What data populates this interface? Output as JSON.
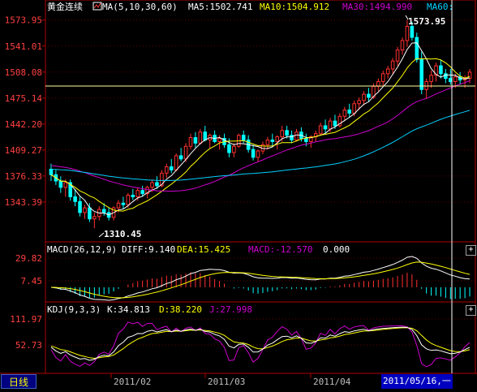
{
  "colors": {
    "background": "#000000",
    "frame": "#b00000",
    "up_candle": "#ff3030",
    "down_candle": "#00ffff",
    "ma5": "#ffffff",
    "ma10": "#ffff00",
    "ma30": "#d000d0",
    "ma60": "#00d0ff",
    "axis_text": "#ff4040",
    "crosshair": "#ffffff",
    "hline": "#ffffa0"
  },
  "main_panel": {
    "instrument": "黄金连续",
    "ma_prefix": "MA(5,10,30,60)",
    "ma5_label": "MA5:1502.741",
    "ma10_label": "MA10:1504.912",
    "ma30_label": "MA30:1494.990",
    "ma60_label": "MA60:",
    "high_marker": "1573.95",
    "low_marker": "1310.45",
    "y_ticks": [
      "1573.95",
      "1541.01",
      "1508.08",
      "1475.14",
      "1442.20",
      "1409.27",
      "1376.33",
      "1343.39"
    ]
  },
  "macd_panel": {
    "label": "MACD(26,12,9)",
    "diff_label": "DIFF:9.140",
    "dea_label": "DEA:15.425",
    "macd_label": "MACD:-12.570",
    "zero_label": "0.000",
    "y_ticks": [
      "29.82",
      "7.45"
    ]
  },
  "kdj_panel": {
    "label": "KDJ(9,3,3)",
    "k_label": "K:34.813",
    "d_label": "D:38.220",
    "j_label": "J:27.998",
    "y_ticks": [
      "111.97",
      "52.73"
    ]
  },
  "footer": {
    "period_button": "日线",
    "dates": [
      "2011/02",
      "2011/03",
      "2011/04"
    ],
    "cursor_date": "2011/05/16,一"
  },
  "chart_data": [
    {
      "type": "candlestick",
      "title": "黄金连续",
      "ylim": [
        1297,
        1585
      ],
      "ohlc": [
        [
          1385,
          1392,
          1370,
          1378
        ],
        [
          1378,
          1384,
          1365,
          1370
        ],
        [
          1370,
          1376,
          1355,
          1362
        ],
        [
          1362,
          1372,
          1350,
          1368
        ],
        [
          1368,
          1372,
          1345,
          1350
        ],
        [
          1350,
          1360,
          1338,
          1344
        ],
        [
          1344,
          1350,
          1325,
          1330
        ],
        [
          1330,
          1340,
          1322,
          1336
        ],
        [
          1336,
          1342,
          1318,
          1322
        ],
        [
          1322,
          1330,
          1310,
          1325
        ],
        [
          1325,
          1338,
          1320,
          1334
        ],
        [
          1334,
          1342,
          1326,
          1330
        ],
        [
          1330,
          1336,
          1320,
          1324
        ],
        [
          1324,
          1338,
          1320,
          1336
        ],
        [
          1336,
          1346,
          1330,
          1342
        ],
        [
          1342,
          1350,
          1335,
          1340
        ],
        [
          1340,
          1355,
          1336,
          1352
        ],
        [
          1352,
          1360,
          1346,
          1350
        ],
        [
          1350,
          1362,
          1345,
          1358
        ],
        [
          1358,
          1364,
          1350,
          1354
        ],
        [
          1354,
          1364,
          1348,
          1362
        ],
        [
          1362,
          1372,
          1356,
          1368
        ],
        [
          1368,
          1376,
          1360,
          1364
        ],
        [
          1364,
          1384,
          1362,
          1380
        ],
        [
          1380,
          1392,
          1374,
          1388
        ],
        [
          1388,
          1398,
          1380,
          1384
        ],
        [
          1384,
          1405,
          1382,
          1402
        ],
        [
          1402,
          1412,
          1395,
          1398
        ],
        [
          1398,
          1418,
          1394,
          1414
        ],
        [
          1414,
          1430,
          1410,
          1425
        ],
        [
          1425,
          1432,
          1412,
          1418
        ],
        [
          1418,
          1436,
          1416,
          1432
        ],
        [
          1432,
          1440,
          1420,
          1422
        ],
        [
          1422,
          1430,
          1412,
          1428
        ],
        [
          1428,
          1434,
          1418,
          1420
        ],
        [
          1420,
          1428,
          1410,
          1424
        ],
        [
          1424,
          1430,
          1412,
          1416
        ],
        [
          1416,
          1424,
          1400,
          1406
        ],
        [
          1406,
          1418,
          1400,
          1414
        ],
        [
          1414,
          1430,
          1412,
          1428
        ],
        [
          1428,
          1434,
          1418,
          1422
        ],
        [
          1422,
          1428,
          1406,
          1410
        ],
        [
          1410,
          1416,
          1396,
          1400
        ],
        [
          1400,
          1410,
          1394,
          1408
        ],
        [
          1408,
          1420,
          1404,
          1416
        ],
        [
          1416,
          1426,
          1410,
          1422
        ],
        [
          1422,
          1430,
          1414,
          1420
        ],
        [
          1420,
          1428,
          1410,
          1426
        ],
        [
          1426,
          1440,
          1420,
          1434
        ],
        [
          1434,
          1440,
          1424,
          1428
        ],
        [
          1428,
          1434,
          1418,
          1422
        ],
        [
          1422,
          1436,
          1420,
          1432
        ],
        [
          1432,
          1438,
          1420,
          1424
        ],
        [
          1424,
          1430,
          1414,
          1420
        ],
        [
          1420,
          1428,
          1412,
          1426
        ],
        [
          1426,
          1434,
          1420,
          1430
        ],
        [
          1430,
          1444,
          1428,
          1440
        ],
        [
          1440,
          1448,
          1430,
          1436
        ],
        [
          1436,
          1450,
          1432,
          1446
        ],
        [
          1446,
          1454,
          1436,
          1440
        ],
        [
          1440,
          1456,
          1438,
          1452
        ],
        [
          1452,
          1464,
          1446,
          1460
        ],
        [
          1460,
          1468,
          1450,
          1456
        ],
        [
          1456,
          1472,
          1452,
          1468
        ],
        [
          1468,
          1476,
          1460,
          1472
        ],
        [
          1472,
          1484,
          1466,
          1480
        ],
        [
          1480,
          1488,
          1470,
          1476
        ],
        [
          1476,
          1494,
          1474,
          1490
        ],
        [
          1490,
          1500,
          1484,
          1496
        ],
        [
          1496,
          1510,
          1490,
          1506
        ],
        [
          1506,
          1516,
          1500,
          1512
        ],
        [
          1512,
          1526,
          1506,
          1522
        ],
        [
          1522,
          1540,
          1516,
          1536
        ],
        [
          1536,
          1552,
          1530,
          1548
        ],
        [
          1548,
          1574,
          1540,
          1566
        ],
        [
          1566,
          1572,
          1548,
          1552
        ],
        [
          1552,
          1558,
          1520,
          1524
        ],
        [
          1524,
          1534,
          1480,
          1486
        ],
        [
          1486,
          1500,
          1474,
          1496
        ],
        [
          1496,
          1510,
          1488,
          1504
        ],
        [
          1504,
          1520,
          1496,
          1516
        ],
        [
          1516,
          1524,
          1500,
          1506
        ],
        [
          1506,
          1512,
          1494,
          1500
        ],
        [
          1500,
          1512,
          1492,
          1496
        ],
        [
          1496,
          1506,
          1488,
          1502
        ],
        [
          1502,
          1508,
          1492,
          1498
        ],
        [
          1498,
          1504,
          1488,
          1500
        ],
        [
          1500,
          1512,
          1494,
          1508
        ]
      ]
    },
    {
      "type": "bar",
      "title": "MACD(26,12,9)",
      "series_names": [
        "DIFF",
        "DEA",
        "MACD"
      ]
    },
    {
      "type": "line",
      "title": "KDJ(9,3,3)",
      "series_names": [
        "K",
        "D",
        "J"
      ]
    }
  ]
}
